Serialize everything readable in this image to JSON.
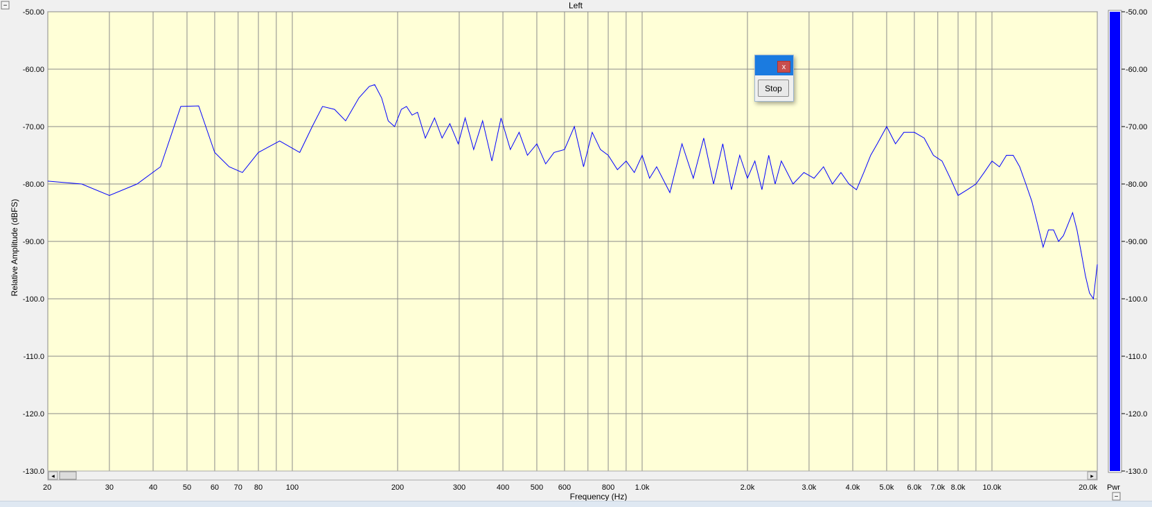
{
  "window": {
    "collapse_top_glyph": "−",
    "collapse_bottom_glyph": "−",
    "pwr_label": "Pwr"
  },
  "dialog": {
    "close_glyph": "x",
    "stop_label": "Stop"
  },
  "scrollbar": {
    "left_glyph": "◂",
    "right_glyph": "▸"
  },
  "colors": {
    "plot_bg": "#ffffd7",
    "grid": "#8a8a8a",
    "trace": "#0000ff",
    "meter_fill": "#0000ff"
  },
  "chart_data": {
    "type": "line",
    "title": "Left",
    "xlabel": "Frequency (Hz)",
    "ylabel": "Relative Amplitude (dBFS)",
    "x_scale": "log",
    "xlim": [
      20,
      20000
    ],
    "ylim": [
      -130,
      -50
    ],
    "grid": true,
    "x_ticks": [
      {
        "value": 20,
        "label": "20"
      },
      {
        "value": 30,
        "label": "30"
      },
      {
        "value": 40,
        "label": "40"
      },
      {
        "value": 50,
        "label": "50"
      },
      {
        "value": 60,
        "label": "60"
      },
      {
        "value": 70,
        "label": "70"
      },
      {
        "value": 80,
        "label": "80"
      },
      {
        "value": 90,
        "label": ""
      },
      {
        "value": 100,
        "label": "100"
      },
      {
        "value": 200,
        "label": "200"
      },
      {
        "value": 300,
        "label": "300"
      },
      {
        "value": 400,
        "label": "400"
      },
      {
        "value": 500,
        "label": "500"
      },
      {
        "value": 600,
        "label": "600"
      },
      {
        "value": 700,
        "label": ""
      },
      {
        "value": 800,
        "label": "800"
      },
      {
        "value": 900,
        "label": ""
      },
      {
        "value": 1000,
        "label": "1.0k"
      },
      {
        "value": 2000,
        "label": "2.0k"
      },
      {
        "value": 3000,
        "label": "3.0k"
      },
      {
        "value": 4000,
        "label": "4.0k"
      },
      {
        "value": 5000,
        "label": "5.0k"
      },
      {
        "value": 6000,
        "label": "6.0k"
      },
      {
        "value": 7000,
        "label": "7.0k"
      },
      {
        "value": 8000,
        "label": "8.0k"
      },
      {
        "value": 9000,
        "label": ""
      },
      {
        "value": 10000,
        "label": "10.0k"
      },
      {
        "value": 20000,
        "label": "20.0k"
      }
    ],
    "y_ticks": [
      {
        "value": -50,
        "label": "-50.00"
      },
      {
        "value": -60,
        "label": "-60.00"
      },
      {
        "value": -70,
        "label": "-70.00"
      },
      {
        "value": -80,
        "label": "-80.00"
      },
      {
        "value": -90,
        "label": "-90.00"
      },
      {
        "value": -100,
        "label": "-100.0"
      },
      {
        "value": -110,
        "label": "-110.0"
      },
      {
        "value": -120,
        "label": "-120.0"
      },
      {
        "value": -130,
        "label": "-130.0"
      }
    ],
    "meter": {
      "min": -130,
      "max": -50,
      "level": -50,
      "ticks": [
        "-50.00",
        "-60.00",
        "-70.00",
        "-80.00",
        "-90.00",
        "-100.0",
        "-110.0",
        "-120.0",
        "-130.0"
      ]
    },
    "series": [
      {
        "x": [
          20,
          25,
          30,
          36,
          42,
          48,
          54,
          60,
          66,
          72,
          80,
          92,
          105,
          114,
          122,
          132,
          142,
          155,
          166,
          172,
          180,
          188,
          196,
          205,
          212,
          220,
          228,
          240,
          255,
          268,
          282,
          298,
          312,
          330,
          350,
          372,
          395,
          420,
          445,
          470,
          500,
          530,
          560,
          600,
          640,
          680,
          720,
          760,
          800,
          850,
          900,
          950,
          1000,
          1050,
          1100,
          1200,
          1300,
          1400,
          1500,
          1600,
          1700,
          1800,
          1900,
          2000,
          2100,
          2200,
          2300,
          2400,
          2500,
          2700,
          2900,
          3100,
          3300,
          3500,
          3700,
          3900,
          4100,
          4300,
          4500,
          4700,
          5000,
          5300,
          5600,
          6000,
          6400,
          6800,
          7200,
          7600,
          8000,
          8500,
          9000,
          9500,
          10000,
          10500,
          11000,
          11500,
          12000,
          12500,
          13000,
          13500,
          14000,
          14500,
          15000,
          15500,
          16000,
          16500,
          17000,
          17500,
          18000,
          18500,
          19000,
          19500,
          20000
        ],
        "y": [
          -79.5,
          -80,
          -82,
          -80,
          -77,
          -66.5,
          -66.4,
          -74.5,
          -77,
          -78,
          -74.5,
          -72.5,
          -74.5,
          -70,
          -66.5,
          -67,
          -69,
          -65,
          -63,
          -62.7,
          -65,
          -69,
          -70,
          -67,
          -66.5,
          -68,
          -67.5,
          -72,
          -68.5,
          -72,
          -69.5,
          -73,
          -68.5,
          -74,
          -69,
          -76,
          -68.5,
          -74,
          -71,
          -75,
          -73,
          -76.5,
          -74.5,
          -74,
          -70,
          -77,
          -71,
          -74,
          -75,
          -77.5,
          -76,
          -78,
          -75,
          -79,
          -77,
          -81.5,
          -73,
          -79,
          -72,
          -80,
          -73,
          -81,
          -75,
          -79,
          -76,
          -81,
          -75,
          -80,
          -76,
          -80,
          -78,
          -79,
          -77,
          -80,
          -78,
          -80,
          -81,
          -78,
          -75,
          -73,
          -70,
          -73,
          -71,
          -71,
          -72,
          -75,
          -76,
          -79,
          -82,
          -81,
          -80,
          -78,
          -76,
          -77,
          -75,
          -75,
          -77,
          -80,
          -83,
          -87,
          -91,
          -88,
          -88,
          -90,
          -89,
          -87,
          -85,
          -88,
          -92,
          -96,
          -99,
          -100,
          -94
        ]
      }
    ]
  }
}
